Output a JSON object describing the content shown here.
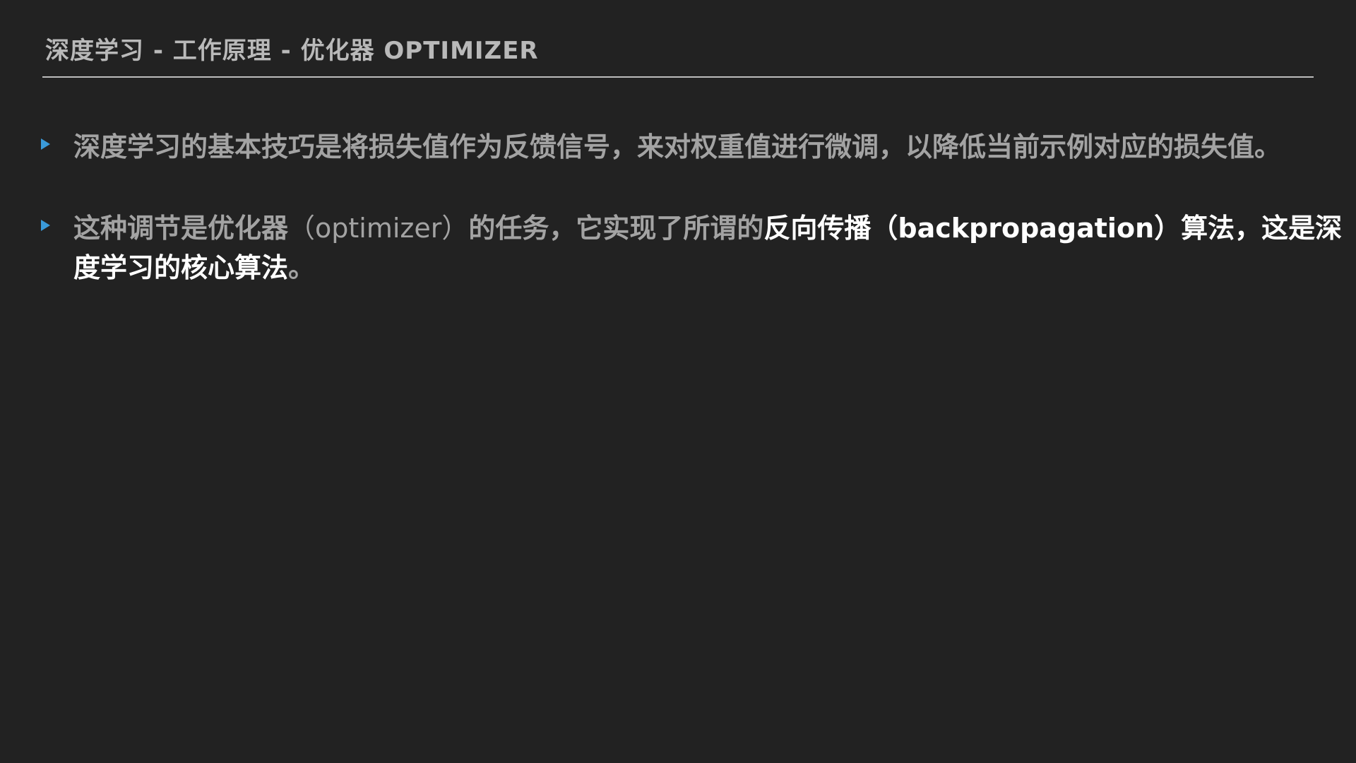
{
  "slide": {
    "title": "深度学习 - 工作原理 - 优化器 OPTIMIZER",
    "bullets": [
      {
        "marker_icon": "triangle-right-icon",
        "text": "深度学习的基本技巧是将损失值作为反馈信号，来对权重值进行微调，以降低当前示例对应的损失值。"
      },
      {
        "marker_icon": "triangle-right-icon",
        "part1": "这种调节是优化器",
        "part2": "（optimizer）",
        "part3": "的任务，它实现了所谓的",
        "emphasis": "反向传播（backpropagation）算法，这是深度学习的核心算法",
        "end": "。"
      }
    ]
  },
  "colors": {
    "background": "#222222",
    "title": "#b9b9b9",
    "rule": "#bdbdbd",
    "body_text": "#a3a3a3",
    "emphasis_text": "#ffffff",
    "bullet_marker": "#3a9ad9"
  }
}
